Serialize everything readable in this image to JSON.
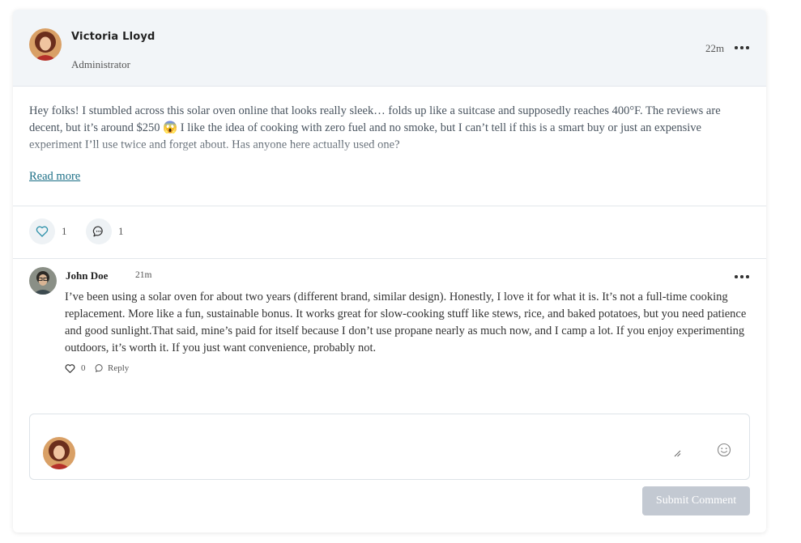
{
  "post": {
    "author_name": "Victoria Lloyd",
    "author_role": "Administrator",
    "time": "22m",
    "body": "Hey folks! I stumbled across this solar oven online that looks really sleek… folds up like a suitcase and supposedly reaches 400°F. The reviews are decent, but it’s around $250 😱 I like the idea of cooking with zero fuel and no smoke, but I can’t tell if this is a smart buy or just an expensive experiment I’ll use twice and forget about. Has anyone here actually used one?",
    "read_more_label": "Read more",
    "like_count": "1",
    "comment_count": "1"
  },
  "comment": {
    "author_name": "John Doe",
    "time": "21m",
    "text": "I’ve been using a solar oven for about two years (different brand, similar design). Honestly, I love it for what it is. It’s not a full-time cooking replacement. More like a fun, sustainable bonus. It works great for slow-cooking stuff like stews, rice, and baked potatoes, but you need patience and good sunlight.That said, mine’s paid for itself because I don’t use propane nearly as much now, and I camp a lot. If you enjoy experimenting outdoors, it’s worth it. If you just want convenience, probably not.",
    "like_count": "0",
    "reply_label": "Reply"
  },
  "composer": {
    "placeholder": "",
    "submit_label": "Submit Comment"
  },
  "icons": {
    "like": "heart-icon",
    "comment": "speech-bubble-icon",
    "more": "more-dots-icon",
    "emoji": "smiley-icon"
  },
  "colors": {
    "header_bg": "#f2f5f8",
    "link": "#1b6e86",
    "like_icon": "#2a8fa8",
    "submit_disabled": "#c3c9d2"
  }
}
